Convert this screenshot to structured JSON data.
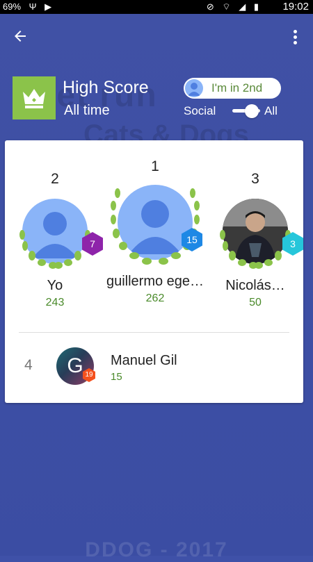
{
  "status_bar": {
    "battery": "69%",
    "time": "19:02"
  },
  "header": {
    "title": "High Score",
    "period": "All time",
    "rank_pill": "I'm in 2nd",
    "filter_left": "Social",
    "filter_right": "All",
    "filter_selected": "All"
  },
  "background": {
    "title_line1": "pet run",
    "title_line2": "Cats & Dogs",
    "footer": "DDOG - 2017"
  },
  "podium": [
    {
      "rank": "2",
      "name": "Yo",
      "score": "243",
      "level": "7",
      "level_color": "#8e24aa"
    },
    {
      "rank": "1",
      "name": "guillermo ege…",
      "score": "262",
      "level": "15",
      "level_color": "#1e88e5"
    },
    {
      "rank": "3",
      "name": "Nicolás…",
      "score": "50",
      "level": "3",
      "level_color": "#26c6da"
    }
  ],
  "list": [
    {
      "rank": "4",
      "name": "Manuel Gil",
      "score": "15",
      "level": "19",
      "initial": "G"
    }
  ],
  "colors": {
    "accent_green": "#8bc34a",
    "score_green": "#4a8a2a",
    "background": "#3f51a8"
  }
}
